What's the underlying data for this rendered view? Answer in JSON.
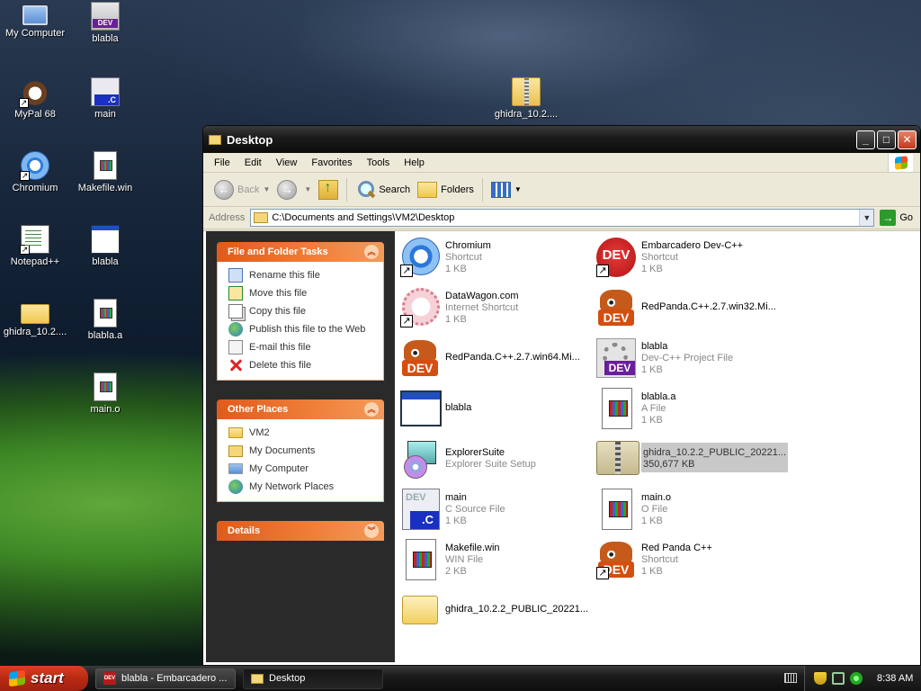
{
  "desktop": {
    "icons": [
      {
        "label": "My Computer",
        "icon": "computer-icon"
      },
      {
        "label": "blabla",
        "icon": "dev-project-icon"
      },
      {
        "label": "MyPal 68",
        "icon": "mypal-icon"
      },
      {
        "label": "main",
        "icon": "c-source-icon"
      },
      {
        "label": "Chromium",
        "icon": "chromium-icon"
      },
      {
        "label": "Makefile.win",
        "icon": "document-icon"
      },
      {
        "label": "Notepad++",
        "icon": "notepad-icon"
      },
      {
        "label": "blabla",
        "icon": "window-app-icon"
      },
      {
        "label": "ghidra_10.2....",
        "icon": "folder-icon"
      },
      {
        "label": "blabla.a",
        "icon": "document-icon"
      },
      {
        "label": "main.o",
        "icon": "document-icon"
      },
      {
        "label": "ghidra_10.2....",
        "icon": "zip-icon"
      }
    ]
  },
  "window": {
    "title": "Desktop",
    "controls": {
      "minimize": "_",
      "maximize": "□",
      "close": "✕"
    },
    "menu": [
      "File",
      "Edit",
      "View",
      "Favorites",
      "Tools",
      "Help"
    ],
    "toolbar": {
      "back": "Back",
      "search": "Search",
      "folders": "Folders"
    },
    "address": {
      "label": "Address",
      "path": "C:\\Documents and Settings\\VM2\\Desktop",
      "go": "Go"
    },
    "tasks": {
      "file_folder_tasks": {
        "title": "File and Folder Tasks",
        "items": [
          {
            "label": "Rename this file",
            "icon": "rename-icon"
          },
          {
            "label": "Move this file",
            "icon": "move-icon"
          },
          {
            "label": "Copy this file",
            "icon": "copy-icon"
          },
          {
            "label": "Publish this file to the Web",
            "icon": "web-publish-icon"
          },
          {
            "label": "E-mail this file",
            "icon": "email-icon"
          },
          {
            "label": "Delete this file",
            "icon": "delete-icon"
          }
        ]
      },
      "other_places": {
        "title": "Other Places",
        "items": [
          {
            "label": "VM2",
            "icon": "folder-icon"
          },
          {
            "label": "My Documents",
            "icon": "my-documents-icon"
          },
          {
            "label": "My Computer",
            "icon": "my-computer-icon"
          },
          {
            "label": "My Network Places",
            "icon": "network-icon"
          }
        ]
      },
      "details": {
        "title": "Details"
      }
    },
    "files": [
      {
        "name": "Chromium",
        "type": "Shortcut",
        "size": "1 KB",
        "icon": "chromium-icon",
        "shortcut": true
      },
      {
        "name": "Embarcadero Dev-C++",
        "type": "Shortcut",
        "size": "1 KB",
        "icon": "devcpp-icon",
        "shortcut": true
      },
      {
        "name": "DataWagon.com",
        "type": "Internet Shortcut",
        "size": "1 KB",
        "icon": "web-shortcut-icon",
        "shortcut": true
      },
      {
        "name": "RedPanda.C++.2.7.win32.Mi...",
        "type": "",
        "size": "",
        "icon": "redpanda-icon",
        "shortcut": false
      },
      {
        "name": "RedPanda.C++.2.7.win64.Mi...",
        "type": "",
        "size": "",
        "icon": "redpanda-icon",
        "shortcut": false
      },
      {
        "name": "blabla",
        "type": "Dev-C++ Project File",
        "size": "1 KB",
        "icon": "dev-project-icon",
        "shortcut": false
      },
      {
        "name": "blabla",
        "type": "",
        "size": "",
        "icon": "window-app-icon",
        "shortcut": false
      },
      {
        "name": "blabla.a",
        "type": "A File",
        "size": "1 KB",
        "icon": "document-icon",
        "shortcut": false
      },
      {
        "name": "ExplorerSuite",
        "type": "Explorer Suite Setup",
        "size": "",
        "icon": "setup-icon",
        "shortcut": false
      },
      {
        "name": "ghidra_10.2.2_PUBLIC_20221...",
        "type": "350,677 KB",
        "size": "",
        "icon": "zip-icon",
        "shortcut": false,
        "selected": true
      },
      {
        "name": "main",
        "type": "C Source File",
        "size": "1 KB",
        "icon": "c-source-icon",
        "shortcut": false
      },
      {
        "name": "main.o",
        "type": "O File",
        "size": "1 KB",
        "icon": "document-icon",
        "shortcut": false
      },
      {
        "name": "Makefile.win",
        "type": "WIN File",
        "size": "2 KB",
        "icon": "document-icon",
        "shortcut": false
      },
      {
        "name": "Red Panda C++",
        "type": "Shortcut",
        "size": "1 KB",
        "icon": "redpanda-icon",
        "shortcut": true
      },
      {
        "name": "ghidra_10.2.2_PUBLIC_20221...",
        "type": "",
        "size": "",
        "icon": "folder-icon",
        "shortcut": false
      }
    ]
  },
  "taskbar": {
    "start": "start",
    "buttons": [
      {
        "label": "blabla - Embarcadero ...",
        "icon": "devcpp-icon"
      },
      {
        "label": "Desktop",
        "icon": "folder-icon",
        "active": true
      }
    ],
    "clock": "8:38 AM"
  }
}
